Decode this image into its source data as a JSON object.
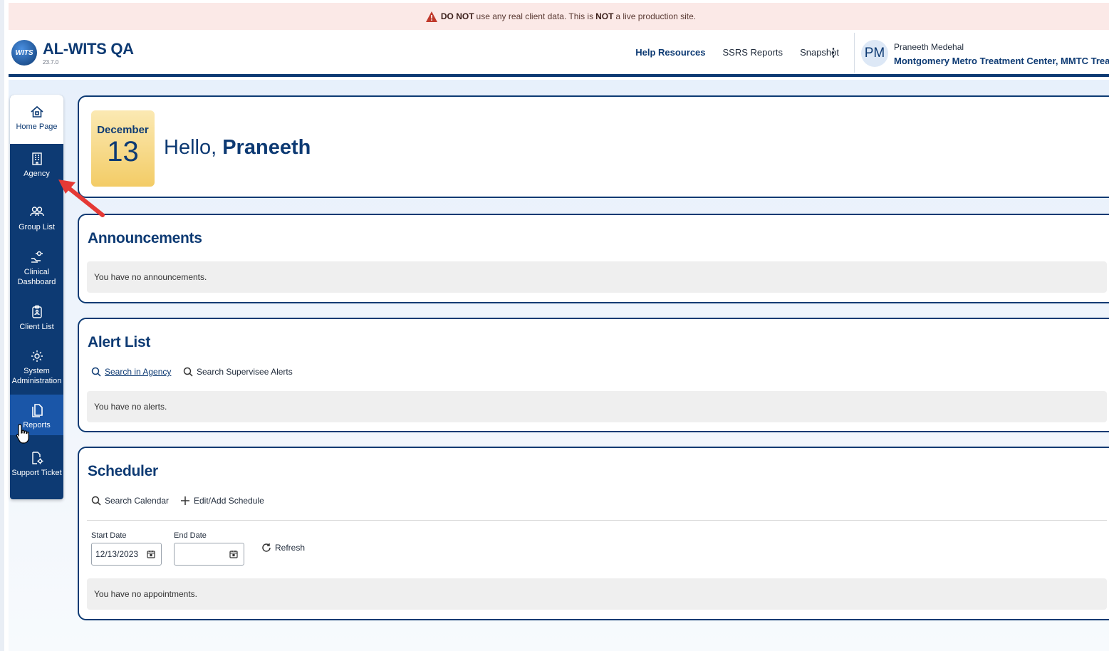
{
  "banner": {
    "pre": "DO NOT",
    "mid": "use any real client data. This is",
    "strong": "NOT",
    "post": "a live production site."
  },
  "header": {
    "logo_text": "WITS",
    "app_title": "AL-WITS QA",
    "version": "23.7.0",
    "links": [
      "Help Resources",
      "SSRS Reports",
      "Snapshot"
    ],
    "kebab": "⋮",
    "avatar_initials": "PM",
    "user_name": "Praneeth Medehal",
    "organization": "Montgomery Metro Treatment Center, MMTC Treatment",
    "caret": "▼"
  },
  "sidebar": {
    "items": [
      {
        "label": "Home Page",
        "icon": "home-icon"
      },
      {
        "label": "Agency",
        "icon": "building-icon"
      },
      {
        "label": "Group List",
        "icon": "group-icon"
      },
      {
        "label": "Clinical Dashboard",
        "icon": "clinical-dashboard-icon"
      },
      {
        "label": "Client List",
        "icon": "clipboard-icon"
      },
      {
        "label": "System Administration",
        "icon": "gear-icon"
      },
      {
        "label": "Reports",
        "icon": "document-icon"
      },
      {
        "label": "Support Ticket",
        "icon": "support-ticket-icon"
      }
    ]
  },
  "welcome": {
    "month": "December",
    "day": "13",
    "hello": "Hello,",
    "name": "Praneeth"
  },
  "announcements": {
    "title": "Announcements",
    "empty": "You have no announcements."
  },
  "alerts": {
    "title": "Alert List",
    "search_agency": "Search in Agency",
    "search_supervisee": "Search Supervisee Alerts",
    "empty": "You have no alerts."
  },
  "scheduler": {
    "title": "Scheduler",
    "search_calendar": "Search Calendar",
    "edit_add": "Edit/Add Schedule",
    "start_label": "Start Date",
    "start_value": "12/13/2023",
    "end_label": "End Date",
    "end_value": "",
    "refresh": "Refresh",
    "empty": "You have no appointments."
  },
  "colors": {
    "brand_navy": "#0d3a73",
    "banner_bg": "#fbe9e7",
    "warning_red": "#c0392b",
    "annotation_arrow": "#e53935"
  }
}
